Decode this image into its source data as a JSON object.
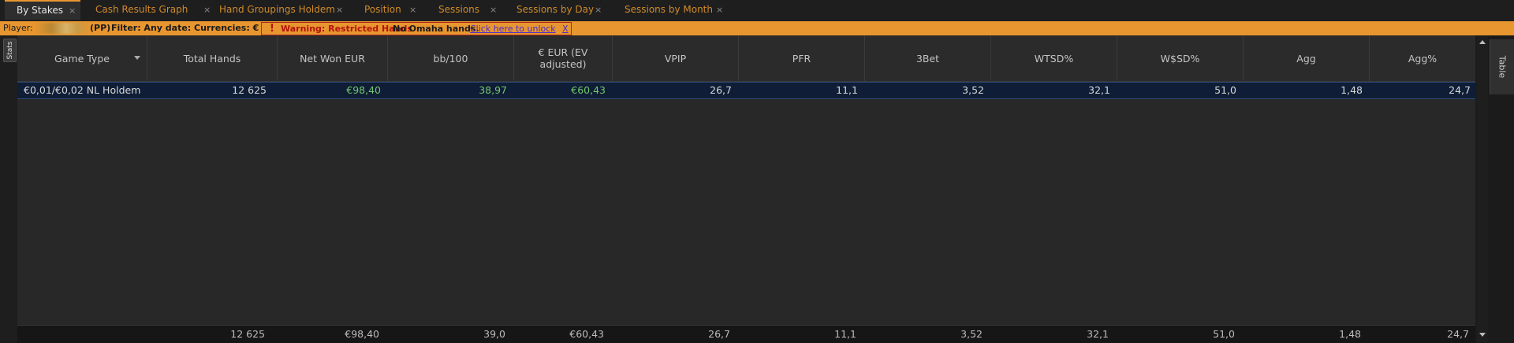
{
  "tabs": [
    {
      "label": "By Stakes",
      "close": "×",
      "active": true
    },
    {
      "label": "Cash Results Graph",
      "close": "×"
    },
    {
      "label": "Hand Groupings Holdem",
      "close": "×"
    },
    {
      "label": "Position",
      "close": "×"
    },
    {
      "label": "Sessions",
      "close": "×"
    },
    {
      "label": "Sessions by Day",
      "close": "×"
    },
    {
      "label": "Sessions by Month",
      "close": "×"
    }
  ],
  "filter_bar": {
    "player_label": "Player:",
    "player_suffix": "(PP)",
    "filter_text": "Filter: Any date: Currencies: €",
    "warning_icon": "!",
    "warning_text": "Warning: Restricted Hands",
    "omaha_text": "No Omaha hands.",
    "unlock_link": "Click here to unlock",
    "close_link": "X"
  },
  "side_tabs": {
    "left": "Stats",
    "right": "Table"
  },
  "columns": [
    "Game Type",
    "Total Hands",
    "Net Won EUR",
    "bb/100",
    "€ EUR (EV adjusted)",
    "VPIP",
    "PFR",
    "3Bet",
    "WTSD%",
    "W$SD%",
    "Agg",
    "Agg%"
  ],
  "rows": [
    [
      "€0,01/€0,02 NL Holdem",
      "12 625",
      "€98,40",
      "38,97",
      "€60,43",
      "26,7",
      "11,1",
      "3,52",
      "32,1",
      "51,0",
      "1,48",
      "24,7"
    ]
  ],
  "totals": [
    "",
    "12 625",
    "€98,40",
    "39,0",
    "€60,43",
    "26,7",
    "11,1",
    "3,52",
    "32,1",
    "51,0",
    "1,48",
    "24,7"
  ],
  "colors": {
    "accent": "#e8962f",
    "warning": "#b3140d",
    "positive": "#74c66b",
    "selected_row": "#0f1e36"
  }
}
